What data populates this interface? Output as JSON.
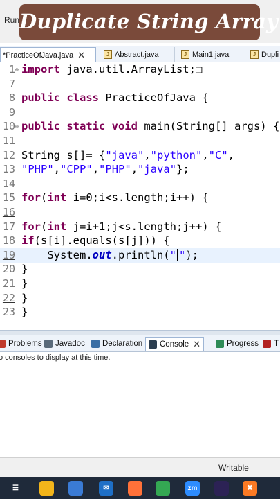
{
  "banner": {
    "title": "Duplicate String Array"
  },
  "menu": {
    "run": "Run"
  },
  "tabs": [
    {
      "label": "*PracticeOfJava.java",
      "active": true
    },
    {
      "label": "Abstract.java"
    },
    {
      "label": "Main1.java"
    },
    {
      "label": "Dupli"
    }
  ],
  "editor": {
    "lines": [
      {
        "num": "1",
        "fold": "⊕",
        "html": "<span class=\"kw\">import</span> java.util.ArrayList;□"
      },
      {
        "num": "7",
        "html": ""
      },
      {
        "num": "8",
        "html": "<span class=\"kw\">public class</span> PracticeOfJava {"
      },
      {
        "num": "9",
        "html": ""
      },
      {
        "num": "10",
        "fold": "⊖",
        "html": "<span class=\"kw\">public static void</span> main(String[] args) {"
      },
      {
        "num": "11",
        "html": ""
      },
      {
        "num": "12",
        "html": "String s[]= {<span class=\"str\">\"java\"</span>,<span class=\"str\">\"python\"</span>,<span class=\"str\">\"C\"</span>,"
      },
      {
        "num": "13",
        "html": "<span class=\"str\">\"PHP\"</span>,<span class=\"str\">\"CPP\"</span>,<span class=\"str\">\"PHP\"</span>,<span class=\"str\">\"java\"</span>};"
      },
      {
        "num": "14",
        "html": ""
      },
      {
        "num": "15",
        "ul": true,
        "html": "<span class=\"kw\">for</span>(<span class=\"kw\">int</span> i=0;i&lt;s.length;i++) {"
      },
      {
        "num": "16",
        "ul": true,
        "html": ""
      },
      {
        "num": "17",
        "html": "<span class=\"kw\">for</span>(<span class=\"kw\">int</span> j=i+1;j&lt;s.length;j++) {"
      },
      {
        "num": "18",
        "html": "<span class=\"kw\">if</span>(s[i].equals(s[j])) {"
      },
      {
        "num": "19",
        "current": true,
        "ul": true,
        "html": "    System.<span class=\"fld\">out</span>.println(<span class=\"str\">\"</span><span class=\"caret\"></span><span class=\"str\">\"</span>);"
      },
      {
        "num": "20",
        "html": "}"
      },
      {
        "num": "21",
        "html": "}"
      },
      {
        "num": "22",
        "ul": true,
        "html": "}"
      },
      {
        "num": "23",
        "html": "}"
      }
    ]
  },
  "panel": {
    "tabs": [
      {
        "label": "Problems",
        "icon": "problems-icon",
        "color": "#c0392b"
      },
      {
        "label": "Javadoc",
        "icon": "javadoc-icon",
        "color": "#5a6a7a"
      },
      {
        "label": "Declaration",
        "icon": "declaration-icon",
        "color": "#3a6ea5"
      },
      {
        "label": "Console",
        "icon": "console-icon",
        "color": "#2c3e50",
        "active": true
      },
      {
        "label": "Progress",
        "icon": "progress-icon",
        "color": "#2e8b57"
      },
      {
        "label": "T",
        "icon": "terminal-icon",
        "color": "#b22222"
      }
    ],
    "console_message": "o consoles to display at this time."
  },
  "status": {
    "text": "Writable"
  },
  "taskbar": {
    "icons": [
      {
        "name": "task-view-icon",
        "glyph": "☰",
        "color": "#1f2a3a"
      },
      {
        "name": "file-explorer-icon",
        "glyph": "",
        "color": "#f2b51b"
      },
      {
        "name": "store-icon",
        "glyph": "",
        "color": "#3a7bd5"
      },
      {
        "name": "mail-icon",
        "glyph": "✉",
        "color": "#1e6fc6"
      },
      {
        "name": "firefox-icon",
        "glyph": "",
        "color": "#ff7139"
      },
      {
        "name": "chrome-icon",
        "glyph": "",
        "color": "#34a853"
      },
      {
        "name": "zoom-icon",
        "glyph": "zm",
        "color": "#2d8cff"
      },
      {
        "name": "eclipse-icon",
        "glyph": "",
        "color": "#2c2255"
      },
      {
        "name": "xampp-icon",
        "glyph": "✖",
        "color": "#fb7a24"
      },
      {
        "name": "brave-icon",
        "glyph": "▼",
        "color": "#fb542b"
      },
      {
        "name": "app-icon",
        "glyph": "",
        "color": "#d0d0d0"
      }
    ]
  }
}
